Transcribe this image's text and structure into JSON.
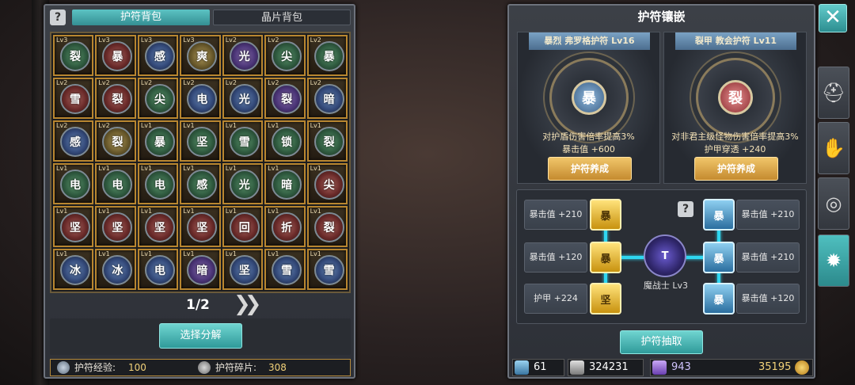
{
  "left": {
    "help": "?",
    "tabs": [
      "护符背包",
      "晶片背包"
    ],
    "grid": [
      [
        {
          "lv": "Lv3",
          "c": "裂",
          "col": "green"
        },
        {
          "lv": "Lv3",
          "c": "暴",
          "col": "red"
        },
        {
          "lv": "Lv3",
          "c": "感",
          "col": "blue"
        },
        {
          "lv": "Lv3",
          "c": "爽",
          "col": "gold"
        },
        {
          "lv": "Lv2",
          "c": "光",
          "col": "purple"
        },
        {
          "lv": "Lv2",
          "c": "尖",
          "col": "green"
        },
        {
          "lv": "Lv2",
          "c": "暴",
          "col": "green"
        }
      ],
      [
        {
          "lv": "Lv2",
          "c": "雪",
          "col": "red"
        },
        {
          "lv": "Lv2",
          "c": "裂",
          "col": "red"
        },
        {
          "lv": "Lv2",
          "c": "尖",
          "col": "green"
        },
        {
          "lv": "Lv2",
          "c": "电",
          "col": "blue"
        },
        {
          "lv": "Lv2",
          "c": "光",
          "col": "blue"
        },
        {
          "lv": "Lv2",
          "c": "裂",
          "col": "purple"
        },
        {
          "lv": "Lv2",
          "c": "暗",
          "col": "blue"
        }
      ],
      [
        {
          "lv": "Lv2",
          "c": "感",
          "col": "blue"
        },
        {
          "lv": "Lv2",
          "c": "裂",
          "col": "gold"
        },
        {
          "lv": "Lv1",
          "c": "暴",
          "col": "green"
        },
        {
          "lv": "Lv1",
          "c": "坚",
          "col": "green"
        },
        {
          "lv": "Lv1",
          "c": "雪",
          "col": "green"
        },
        {
          "lv": "Lv1",
          "c": "锁",
          "col": "green"
        },
        {
          "lv": "Lv1",
          "c": "裂",
          "col": "green"
        }
      ],
      [
        {
          "lv": "Lv1",
          "c": "电",
          "col": "green"
        },
        {
          "lv": "Lv1",
          "c": "电",
          "col": "green"
        },
        {
          "lv": "Lv1",
          "c": "电",
          "col": "green"
        },
        {
          "lv": "Lv1",
          "c": "感",
          "col": "green"
        },
        {
          "lv": "Lv1",
          "c": "光",
          "col": "green"
        },
        {
          "lv": "Lv1",
          "c": "暗",
          "col": "green"
        },
        {
          "lv": "Lv1",
          "c": "尖",
          "col": "red"
        }
      ],
      [
        {
          "lv": "Lv1",
          "c": "坚",
          "col": "red"
        },
        {
          "lv": "Lv1",
          "c": "坚",
          "col": "red"
        },
        {
          "lv": "Lv1",
          "c": "坚",
          "col": "red"
        },
        {
          "lv": "Lv1",
          "c": "坚",
          "col": "red"
        },
        {
          "lv": "Lv1",
          "c": "回",
          "col": "red"
        },
        {
          "lv": "Lv1",
          "c": "折",
          "col": "red"
        },
        {
          "lv": "Lv1",
          "c": "裂",
          "col": "red"
        }
      ],
      [
        {
          "lv": "Lv1",
          "c": "冰",
          "col": "blue"
        },
        {
          "lv": "Lv1",
          "c": "冰",
          "col": "blue"
        },
        {
          "lv": "Lv1",
          "c": "电",
          "col": "blue"
        },
        {
          "lv": "Lv1",
          "c": "暗",
          "col": "purple"
        },
        {
          "lv": "Lv1",
          "c": "坚",
          "col": "blue"
        },
        {
          "lv": "Lv1",
          "c": "雪",
          "col": "blue"
        },
        {
          "lv": "Lv1",
          "c": "雪",
          "col": "blue"
        }
      ]
    ],
    "page": "1/2",
    "next": "»",
    "decompose": "选择分解",
    "stats": [
      {
        "label": "护符经验:",
        "value": "100"
      },
      {
        "label": "护符碎片:",
        "value": "308"
      }
    ]
  },
  "right": {
    "title": "护符镶嵌",
    "cards": [
      {
        "ribbon": "暴烈 弗罗格护符 Lv16",
        "glyph": "暴",
        "desc1": "对护盾伤害倍率提高3%",
        "desc2": "暴击值 +600",
        "btn": "护符养成",
        "color": "#5d8fb7"
      },
      {
        "ribbon": "裂甲 教会护符 Lv11",
        "glyph": "裂",
        "desc1": "对非君主级怪物伤害倍率提高3%",
        "desc2": "护甲穿透 +240",
        "btn": "护符养成",
        "color": "#b84d50"
      }
    ],
    "help": "?",
    "slots_left": [
      "暴击值 +210",
      "暴击值 +120",
      "护甲 +224"
    ],
    "gems_left": [
      "暴",
      "暴",
      "坚"
    ],
    "slots_right": [
      "暴击值 +210",
      "暴击值 +210",
      "暴击值 +120"
    ],
    "gems_right": [
      "暴",
      "暴",
      "暴"
    ],
    "core_glyph": "T",
    "core_label": "魔战士 Lv3",
    "draw": "护符抽取",
    "resources": [
      "61",
      "324231",
      "943",
      "35195"
    ]
  },
  "close": "✕",
  "side_icons": [
    "helmet-icon",
    "gloves-icon",
    "shield-icon",
    "gear-icon"
  ]
}
